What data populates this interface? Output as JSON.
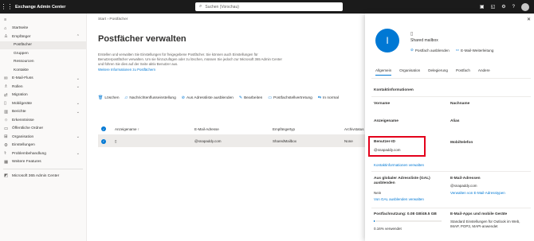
{
  "topbar": {
    "app_title": "Exchange Admin Center",
    "search_placeholder": "Suchen (Vorschau)"
  },
  "sidebar": {
    "items": [
      {
        "label": "Startseite",
        "icon": "home-icon"
      },
      {
        "label": "Empfänger",
        "icon": "person-icon",
        "expanded": true
      },
      {
        "label": "Postfächer",
        "sub": true,
        "selected": true
      },
      {
        "label": "Gruppen",
        "sub": true
      },
      {
        "label": "Ressourcen",
        "sub": true
      },
      {
        "label": "Kontakte",
        "sub": true
      },
      {
        "label": "E-Mail-Fluss",
        "icon": "mail-icon"
      },
      {
        "label": "Rollen",
        "icon": "roles-icon"
      },
      {
        "label": "Migration",
        "icon": "migration-icon"
      },
      {
        "label": "Mobilgeräte",
        "icon": "mobile-icon"
      },
      {
        "label": "Berichte",
        "icon": "chart-icon"
      },
      {
        "label": "Erkenntnisse",
        "icon": "lightbulb-icon"
      },
      {
        "label": "Öffentliche Ordner",
        "icon": "folder-icon"
      },
      {
        "label": "Organisation",
        "icon": "org-icon"
      },
      {
        "label": "Einstellungen",
        "icon": "settings-icon"
      },
      {
        "label": "Problembehandlung",
        "icon": "troubleshoot-icon"
      },
      {
        "label": "Weitere Features",
        "icon": "features-icon"
      }
    ],
    "footer": "Microsoft 365 Admin Center"
  },
  "main": {
    "breadcrumb": [
      "Start",
      "Postfächer"
    ],
    "title": "Postfächer verwalten",
    "description": "Erstellen und verwalten Sie Einstellungen für freigegebene Postfächer. Sie können auch Einstellungen für Benutzerpostfächer verwalten. Um sie hinzuzufügen oder zu löschen, müssen Sie jedoch zur Microsoft 365 Admin Center und führen Sie dies auf der Seite aktiv Benutzer aus.",
    "learn_more": "Weitere Informationen zu Postfächern",
    "commands": [
      "Löschen",
      "Nachrichtenflusseinstellung",
      "Aus Adressliste ausblenden",
      "Bearbeiten",
      "Postfachstellvertretung",
      "In normal"
    ],
    "table": {
      "headers": [
        "Anzeigename ↑",
        "E-Mail-Adresse",
        "Empfängertyp",
        "Archivstatus"
      ],
      "rows": [
        {
          "name": "",
          "email": "@snapaddy.com",
          "type": "SharedMailbox",
          "archive": "None"
        }
      ]
    }
  },
  "panel": {
    "avatar_letter": "I",
    "mailbox_type": "Shared mailbox",
    "actions": [
      "Postfach ausblenden",
      "E-Mail-Weiterleitung"
    ],
    "tabs": [
      "Allgemein",
      "Organisation",
      "Delegierung",
      "Postfach",
      "Andere"
    ],
    "section_title": "Kontaktinformationen",
    "fields": {
      "vorname": "Vorname",
      "nachname": "Nachname",
      "anzeigename": "Anzeigename",
      "alias": "Alias",
      "benutzer_id_label": "Benutzer-ID",
      "benutzer_id_value": "@snapaddy.com",
      "mobiltelefon": "Mobiltelefon"
    },
    "manage_contact": "Kontaktinformationen verwalten",
    "gal_title": "Aus globaler Adressliste (GAL) ausblenden",
    "gal_value": "Nein",
    "gal_link": "Von GAL ausblenden verwalten",
    "email_addresses_title": "E-Mail-Adressen",
    "email_addresses_value": "@snapaddy.com",
    "email_addresses_link": "Verwalten von E-Mail-Adresstypen",
    "usage_title": "Postfachnutzung: 0.08 GB/49.5 GB",
    "usage_value": "0.16% verwendet",
    "usage_percent": 0.16,
    "apps_title": "E-Mail-Apps und mobile Geräte",
    "apps_value": "Standard Einstellungen für Outlook im Web, IMAP, POP3, MAPI-anwendet"
  }
}
